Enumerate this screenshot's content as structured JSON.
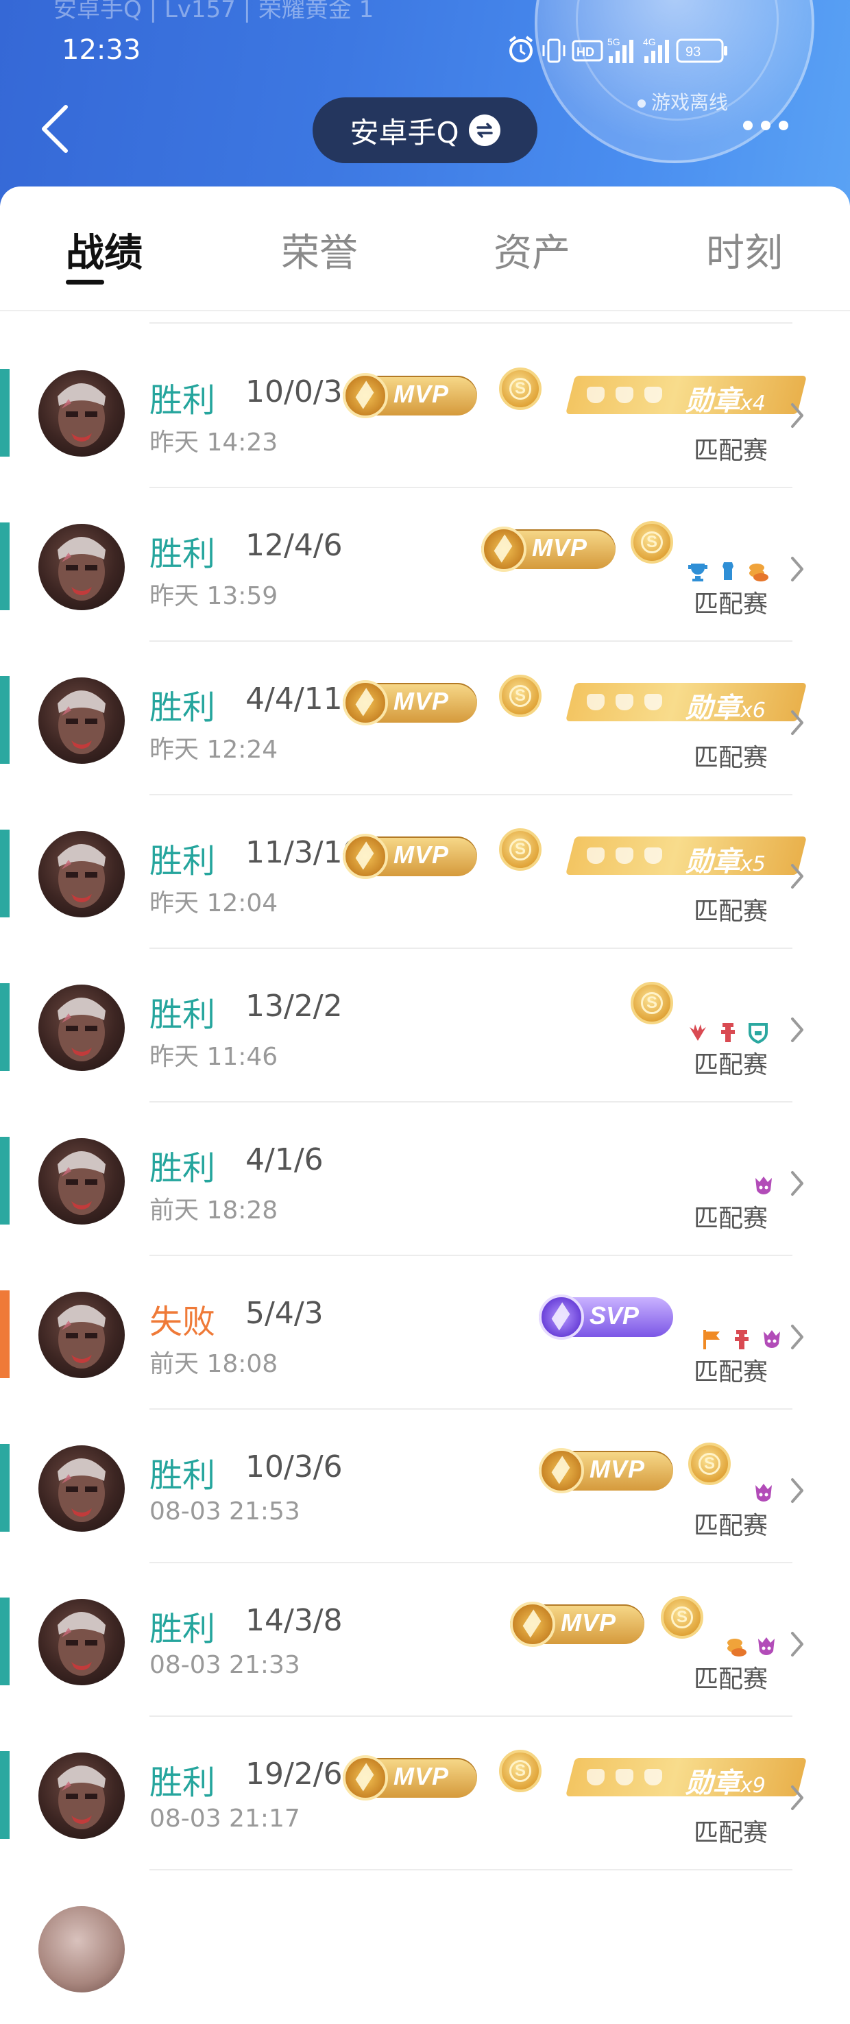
{
  "header": {
    "ghost_text": "安卓手Q | Lv157 | 荣耀黄金 1",
    "time": "12:33",
    "battery": "93",
    "network": [
      "HD",
      "5G",
      "4G"
    ],
    "offline_text": "游戏离线",
    "title": "安卓手Q",
    "colors": {
      "top": "#3568d6",
      "pill": "#24365e"
    }
  },
  "tabs": [
    {
      "label": "战绩",
      "active": true
    },
    {
      "label": "荣誉",
      "active": false
    },
    {
      "label": "资产",
      "active": false
    },
    {
      "label": "时刻",
      "active": false
    }
  ],
  "matches": [
    {
      "result": "胜利",
      "outcome": "win",
      "kda": "10/0/3",
      "date": "昨天 14:23",
      "mode": "匹配赛",
      "mvp": "MVP",
      "coin": true,
      "medal": "勋章",
      "medal_count": "x4",
      "icons": []
    },
    {
      "result": "胜利",
      "outcome": "win",
      "kda": "12/4/6",
      "date": "昨天 13:59",
      "mode": "匹配赛",
      "mvp": "MVP",
      "coin": true,
      "medal": "",
      "medal_count": "",
      "icons": [
        "blue-trophy-icon",
        "blue-armor-icon",
        "orange-coin-icon"
      ]
    },
    {
      "result": "胜利",
      "outcome": "win",
      "kda": "4/4/11",
      "date": "昨天 12:24",
      "mode": "匹配赛",
      "mvp": "MVP",
      "coin": true,
      "medal": "勋章",
      "medal_count": "x6",
      "icons": []
    },
    {
      "result": "胜利",
      "outcome": "win",
      "kda": "11/3/10",
      "date": "昨天 12:04",
      "mode": "匹配赛",
      "mvp": "MVP",
      "coin": true,
      "medal": "勋章",
      "medal_count": "x5",
      "icons": []
    },
    {
      "result": "胜利",
      "outcome": "win",
      "kda": "13/2/2",
      "date": "昨天 11:46",
      "mode": "匹配赛",
      "mvp": "",
      "coin": true,
      "medal": "",
      "medal_count": "",
      "icons": [
        "red-wings-icon",
        "red-tower-icon",
        "teal-shield-icon"
      ]
    },
    {
      "result": "胜利",
      "outcome": "win",
      "kda": "4/1/6",
      "date": "前天 18:28",
      "mode": "匹配赛",
      "mvp": "",
      "coin": false,
      "medal": "",
      "medal_count": "",
      "icons": [
        "purple-demon-icon"
      ]
    },
    {
      "result": "失败",
      "outcome": "lose",
      "kda": "5/4/3",
      "date": "前天 18:08",
      "mode": "匹配赛",
      "mvp": "SVP",
      "coin": false,
      "medal": "",
      "medal_count": "",
      "icons": [
        "orange-flag-icon",
        "red-tower-icon",
        "purple-demon-icon"
      ]
    },
    {
      "result": "胜利",
      "outcome": "win",
      "kda": "10/3/6",
      "date": "08-03 21:53",
      "mode": "匹配赛",
      "mvp": "MVP",
      "coin": true,
      "medal": "",
      "medal_count": "",
      "icons": [
        "purple-demon-icon"
      ]
    },
    {
      "result": "胜利",
      "outcome": "win",
      "kda": "14/3/8",
      "date": "08-03 21:33",
      "mode": "匹配赛",
      "mvp": "MVP",
      "coin": true,
      "medal": "",
      "medal_count": "",
      "icons": [
        "orange-coin-icon",
        "purple-demon-icon"
      ]
    },
    {
      "result": "胜利",
      "outcome": "win",
      "kda": "19/2/6",
      "date": "08-03 21:17",
      "mode": "匹配赛",
      "mvp": "MVP",
      "coin": true,
      "medal": "勋章",
      "medal_count": "x9",
      "icons": []
    }
  ]
}
